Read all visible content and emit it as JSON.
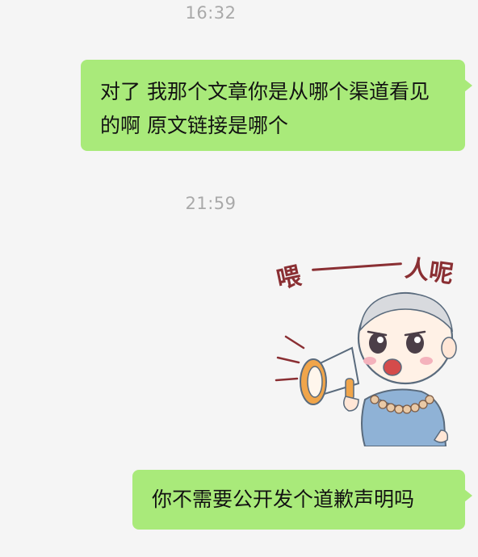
{
  "chat": {
    "timestamps": [
      "16:32",
      "21:59"
    ],
    "messages": [
      {
        "side": "right",
        "type": "text",
        "text": "对了 我那个文章你是从哪个渠道看见的啊 原文链接是哪个"
      },
      {
        "side": "right",
        "type": "sticker",
        "sticker": "monk-megaphone-sticker",
        "caption": "喂——人呢",
        "caption_parts": [
          "喂",
          "人呢"
        ]
      },
      {
        "side": "right",
        "type": "text",
        "text": "你不需要公开发个道歉声明吗"
      }
    ]
  },
  "colors": {
    "background": "#f5f5f5",
    "bubble": "#a9ea7a",
    "timestamp": "#a9a9a9",
    "caption": "#8a2f33"
  }
}
